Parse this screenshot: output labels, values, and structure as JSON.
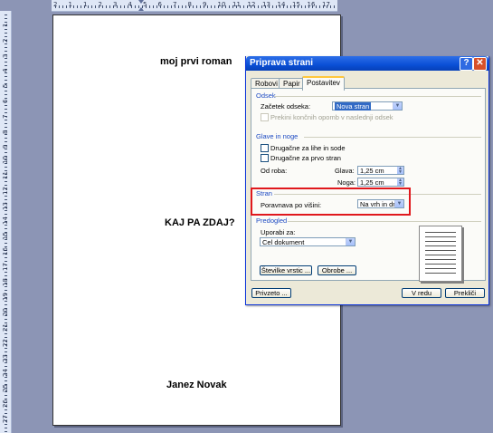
{
  "document": {
    "title": "moj prvi roman",
    "subtitle": "KAJ PA ZDAJ?",
    "author": "Janez Novak"
  },
  "ruler": {
    "h_numbers": [
      "2",
      "1",
      "1",
      "2",
      "3",
      "4",
      "5",
      "6",
      "7",
      "8",
      "9",
      "10",
      "11",
      "12",
      "13",
      "14",
      "15",
      "16",
      "17",
      "18"
    ],
    "v_numbers": [
      "1",
      "2",
      "3",
      "4",
      "5",
      "6",
      "7",
      "8",
      "9",
      "10",
      "11",
      "12",
      "13",
      "14",
      "15",
      "16",
      "17",
      "18",
      "19",
      "20",
      "21",
      "22",
      "23",
      "24",
      "25",
      "26",
      "27"
    ]
  },
  "dialog": {
    "title": "Priprava strani",
    "help_label": "?",
    "close_label": "✕",
    "tabs": [
      "Robovi",
      "Papir",
      "Postavitev"
    ],
    "active_tab": "Postavitev",
    "sections": {
      "odsek": {
        "title": "Odsek",
        "start_label": "Začetek odseka:",
        "start_value": "Nova stran",
        "suppress_label": "Prekini končnih opomb v naslednji odsek"
      },
      "glave": {
        "title": "Glave in noge",
        "odd_even_label": "Drugačne za lihe in sode",
        "first_page_label": "Drugačne za prvo stran",
        "from_edge_label": "Od roba:",
        "header_label": "Glava:",
        "header_value": "1,25 cm",
        "footer_label": "Noga:",
        "footer_value": "1,25 cm"
      },
      "stran": {
        "title": "Stran",
        "align_label": "Poravnava po višini:",
        "align_value": "Na vrh in dno"
      },
      "predogled": {
        "title": "Predogled",
        "apply_label": "Uporabi za:",
        "apply_value": "Cel dokument"
      }
    },
    "buttons": {
      "line_numbers": "Številke vrstic ...",
      "borders": "Obrobe ...",
      "default": "Privzeto ...",
      "ok": "V redu",
      "cancel": "Prekliči"
    }
  },
  "colors": {
    "titlebar": "#0a4fd6",
    "highlight_box": "#e0181d",
    "group_title": "#1e4bc3",
    "workspace": "#8c95b5"
  }
}
